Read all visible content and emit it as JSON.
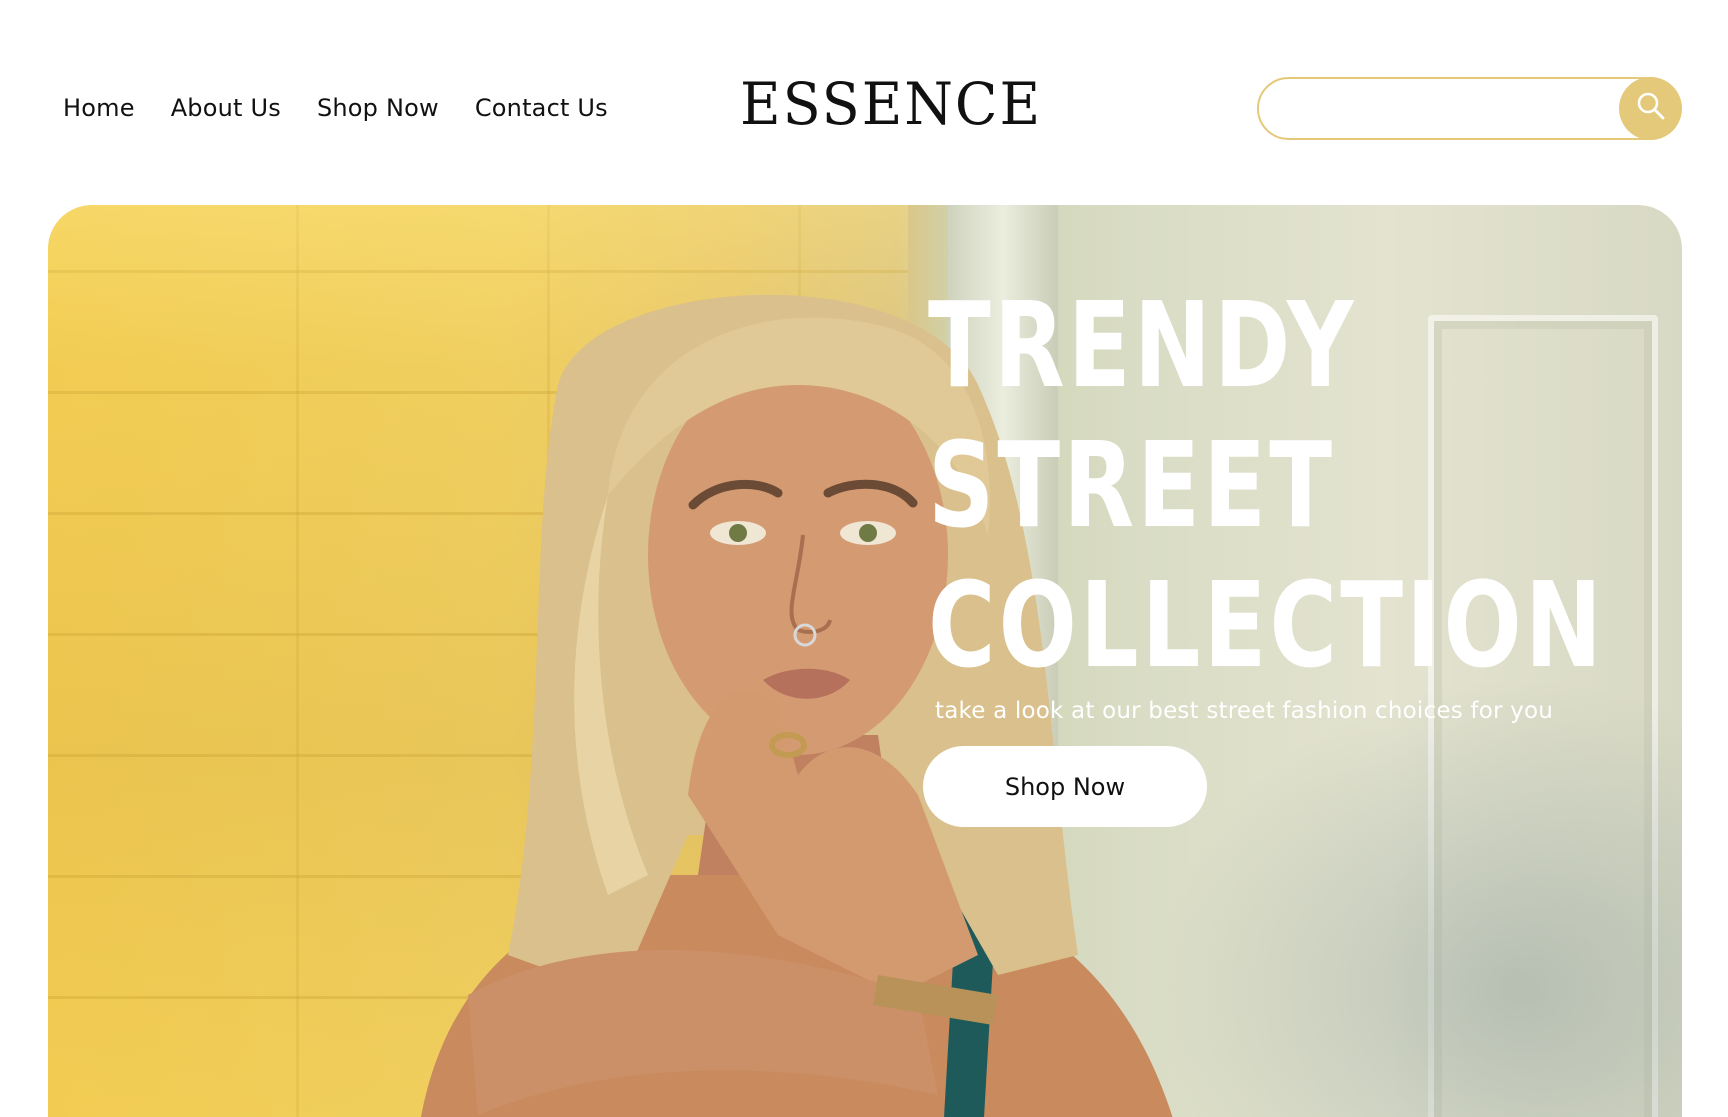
{
  "header": {
    "nav": [
      {
        "label": "Home"
      },
      {
        "label": "About Us"
      },
      {
        "label": "Shop Now"
      },
      {
        "label": "Contact Us"
      }
    ],
    "logo": "ESSENCE",
    "search": {
      "placeholder": "",
      "value": "",
      "icon": "search-icon"
    }
  },
  "hero": {
    "title_lines": [
      "TRENDY",
      "STREET",
      "COLLECTION"
    ],
    "subtitle": "take a look at our best street fashion choices for you",
    "cta_label": "Shop Now"
  },
  "colors": {
    "accent": "#e4c97a",
    "text": "#111111",
    "hero_text": "#ffffff"
  }
}
